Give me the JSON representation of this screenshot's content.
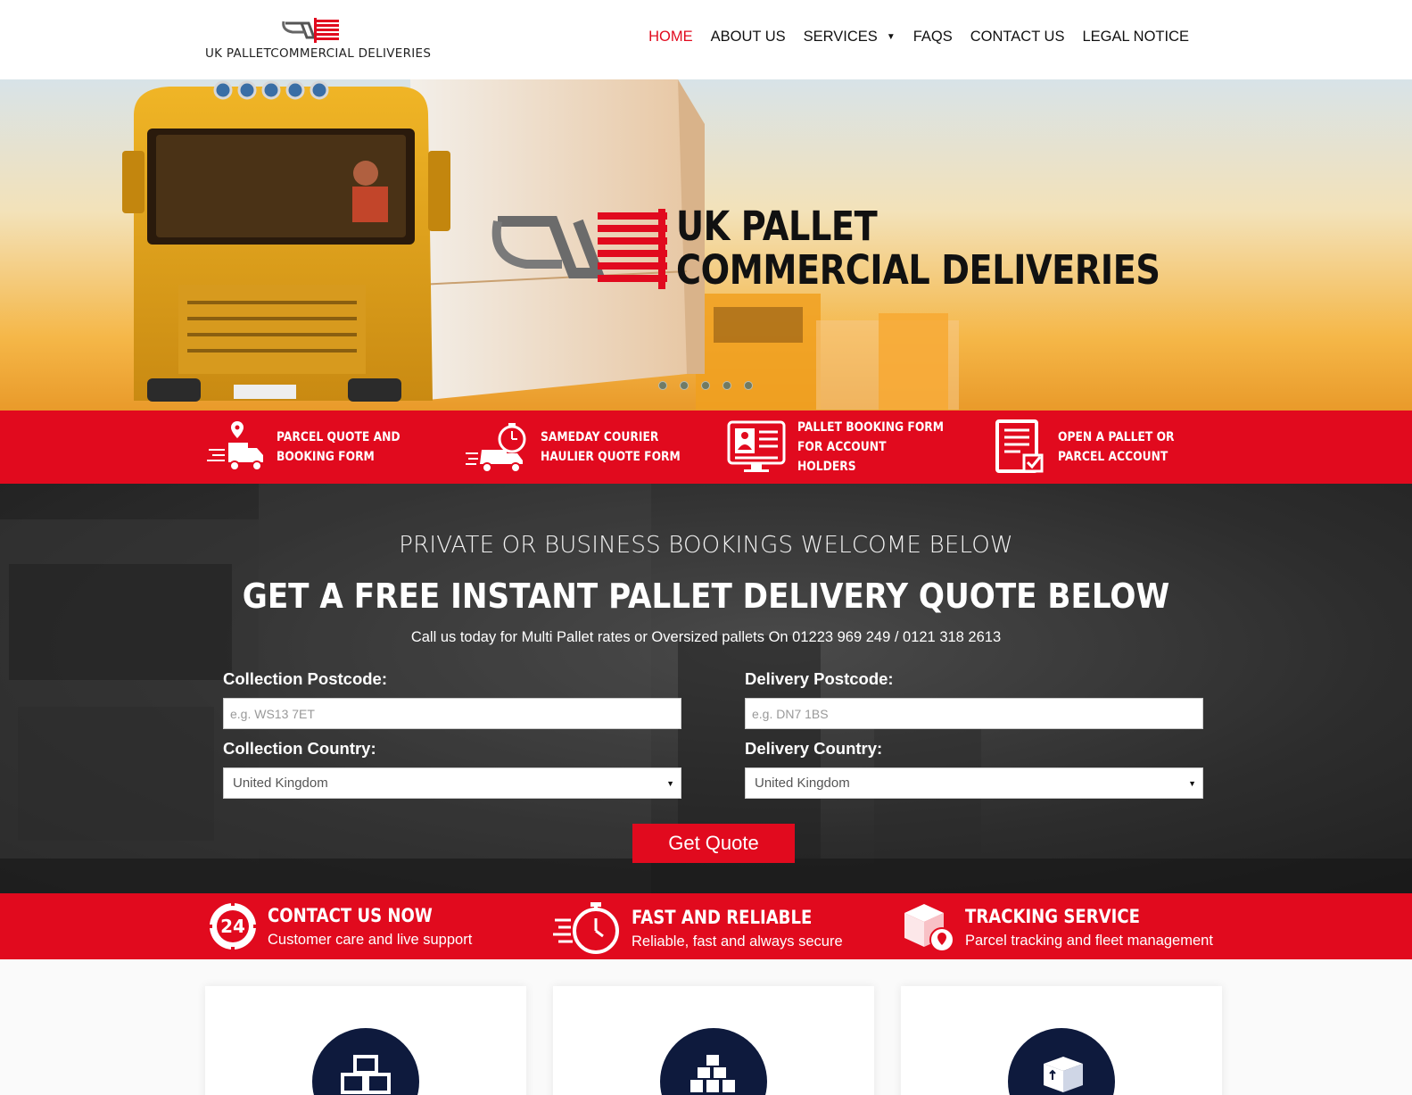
{
  "brand": {
    "logo_text": "UK PALLETCOMMERCIAL DELIVERIES",
    "hero_line1": "UK PALLET",
    "hero_line2": "COMMERCIAL DELIVERIES",
    "colors": {
      "accent": "#e10a1e",
      "navy": "#0e1a3d",
      "dark": "#2d2d2d"
    }
  },
  "nav": {
    "items": [
      {
        "label": "HOME",
        "active": true
      },
      {
        "label": "ABOUT US"
      },
      {
        "label": "SERVICES",
        "has_dropdown": true
      },
      {
        "label": "FAQS"
      },
      {
        "label": "CONTACT US"
      },
      {
        "label": "LEGAL NOTICE"
      }
    ]
  },
  "slider": {
    "slide_count": 5,
    "active_slide": 1
  },
  "quick_links": [
    {
      "label": "PARCEL QUOTE AND BOOKING FORM",
      "icon": "delivery-truck-pin-icon"
    },
    {
      "label": "SAMEDAY COURIER HAULIER QUOTE FORM",
      "icon": "fast-truck-clock-icon"
    },
    {
      "label": "PALLET BOOKING FORM FOR ACCOUNT HOLDERS",
      "icon": "account-monitor-icon"
    },
    {
      "label": "OPEN A PALLET OR PARCEL ACCOUNT",
      "icon": "document-check-icon"
    }
  ],
  "quote": {
    "subtitle": "PRIVATE OR BUSINESS BOOKINGS WELCOME BELOW",
    "title": "GET A FREE INSTANT PALLET DELIVERY QUOTE BELOW",
    "call_text": "Call us today for Multi Pallet rates or Oversized pallets On 01223 969 249 / 0121 318 2613",
    "collection_postcode_label": "Collection Postcode:",
    "collection_postcode_placeholder": "e.g. WS13 7ET",
    "delivery_postcode_label": "Delivery Postcode:",
    "delivery_postcode_placeholder": "e.g. DN7 1BS",
    "collection_country_label": "Collection Country:",
    "collection_country_value": "United Kingdom",
    "delivery_country_label": "Delivery Country:",
    "delivery_country_value": "United Kingdom",
    "button_label": "Get Quote"
  },
  "features": [
    {
      "title": "CONTACT US NOW",
      "desc": "Customer care and live support",
      "icon": "24-hour-icon"
    },
    {
      "title": "FAST AND RELIABLE",
      "desc": "Reliable, fast and always secure",
      "icon": "stopwatch-icon"
    },
    {
      "title": "TRACKING SERVICE",
      "desc": "Parcel tracking and fleet management",
      "icon": "box-location-icon"
    }
  ],
  "cards": [
    {
      "icon": "stacked-boxes-icon"
    },
    {
      "icon": "pallet-stack-icon"
    },
    {
      "icon": "pallet-box-icon"
    }
  ]
}
